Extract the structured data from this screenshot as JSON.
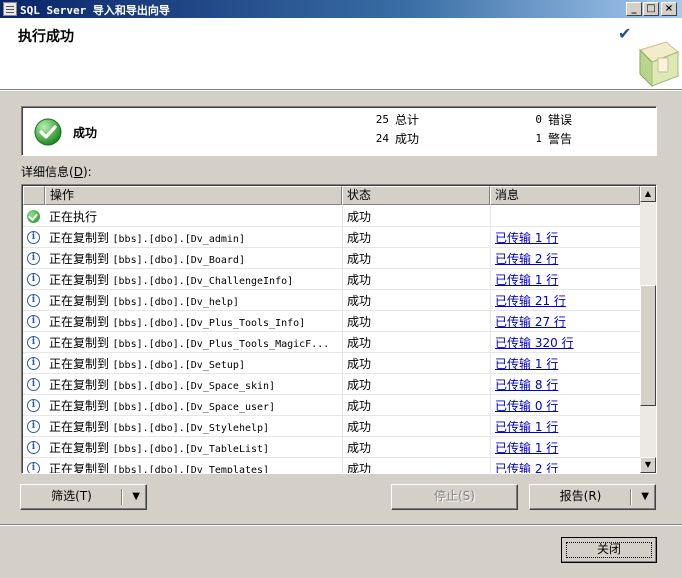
{
  "window": {
    "title": "SQL Server 导入和导出向导"
  },
  "header": {
    "title": "执行成功"
  },
  "summary": {
    "status": "成功",
    "total_count": "25",
    "total_label": "总计",
    "success_count": "24",
    "success_label": "成功",
    "error_count": "0",
    "error_label": "错误",
    "warning_count": "1",
    "warning_label": "警告"
  },
  "detail_label": {
    "text": "详细信息(",
    "key": "D",
    "tail": "):"
  },
  "grid": {
    "columns": [
      "操作",
      "状态",
      "消息"
    ],
    "rows": [
      {
        "icon": "success-icon",
        "op_cn": "正在执行",
        "op_obj": "",
        "status": "成功",
        "message": ""
      },
      {
        "icon": "info-icon",
        "op_cn": "正在复制到",
        "op_obj": "[bbs].[dbo].[Dv_admin]",
        "status": "成功",
        "message": "已传输 1 行"
      },
      {
        "icon": "info-icon",
        "op_cn": "正在复制到",
        "op_obj": "[bbs].[dbo].[Dv_Board]",
        "status": "成功",
        "message": "已传输 2 行"
      },
      {
        "icon": "info-icon",
        "op_cn": "正在复制到",
        "op_obj": "[bbs].[dbo].[Dv_ChallengeInfo]",
        "status": "成功",
        "message": "已传输 1 行"
      },
      {
        "icon": "info-icon",
        "op_cn": "正在复制到",
        "op_obj": "[bbs].[dbo].[Dv_help]",
        "status": "成功",
        "message": "已传输 21 行"
      },
      {
        "icon": "info-icon",
        "op_cn": "正在复制到",
        "op_obj": "[bbs].[dbo].[Dv_Plus_Tools_Info]",
        "status": "成功",
        "message": "已传输 27 行"
      },
      {
        "icon": "info-icon",
        "op_cn": "正在复制到",
        "op_obj": "[bbs].[dbo].[Dv_Plus_Tools_MagicF...",
        "status": "成功",
        "message": "已传输 320 行"
      },
      {
        "icon": "info-icon",
        "op_cn": "正在复制到",
        "op_obj": "[bbs].[dbo].[Dv_Setup]",
        "status": "成功",
        "message": "已传输 1 行"
      },
      {
        "icon": "info-icon",
        "op_cn": "正在复制到",
        "op_obj": "[bbs].[dbo].[Dv_Space_skin]",
        "status": "成功",
        "message": "已传输 8 行"
      },
      {
        "icon": "info-icon",
        "op_cn": "正在复制到",
        "op_obj": "[bbs].[dbo].[Dv_Space_user]",
        "status": "成功",
        "message": "已传输 0 行"
      },
      {
        "icon": "info-icon",
        "op_cn": "正在复制到",
        "op_obj": "[bbs].[dbo].[Dv_Stylehelp]",
        "status": "成功",
        "message": "已传输 1 行"
      },
      {
        "icon": "info-icon",
        "op_cn": "正在复制到",
        "op_obj": "[bbs].[dbo].[Dv_TableList]",
        "status": "成功",
        "message": "已传输 1 行"
      },
      {
        "icon": "info-icon",
        "op_cn": "正在复制到",
        "op_obj": "[bbs].[dbo].[Dv_Templates]",
        "status": "成功",
        "message": "已传输 2 行"
      }
    ]
  },
  "buttons": {
    "filter": "筛选(T)",
    "stop": "停止(S)",
    "report": "报告(R)",
    "close": "关闭"
  },
  "colors": {
    "titlebar": "#0a246a",
    "link": "#0000cc",
    "success": "#1d8a1d"
  }
}
